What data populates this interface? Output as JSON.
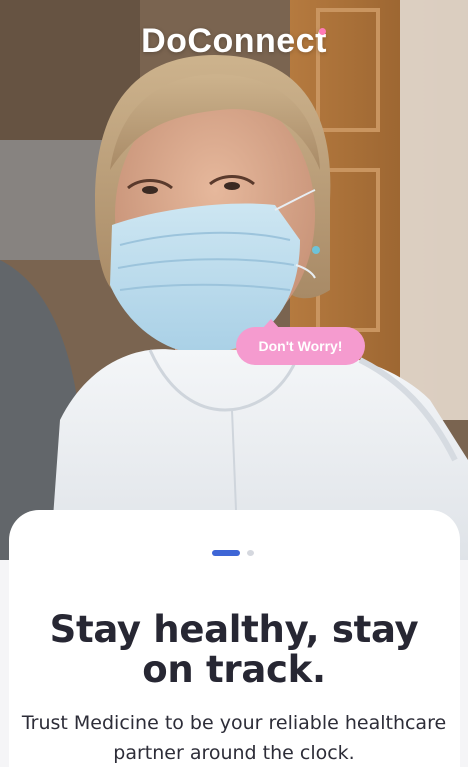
{
  "brand": {
    "name": "DoConnect",
    "accent_color": "#ff7ab6"
  },
  "hero": {
    "image": "masked-healthcare-worker-photo",
    "bubble_text": "Don't Worry!",
    "bubble_color": "#f59bcf"
  },
  "onboarding": {
    "pager": {
      "active_index": 0,
      "total": 2,
      "active_color": "#3e66d6",
      "inactive_color": "#d5d8df"
    },
    "headline": "Stay healthy, stay on track.",
    "subtext": "Trust Medicine to be your reliable healthcare partner around the clock."
  }
}
